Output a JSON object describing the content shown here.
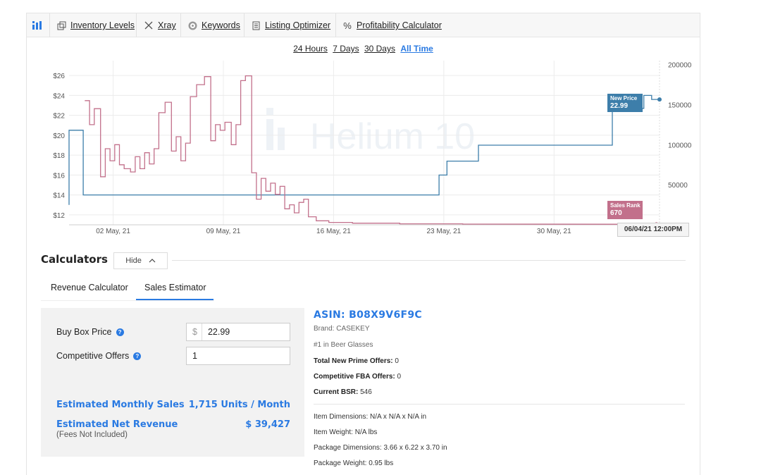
{
  "toolbar": {
    "items": [
      {
        "label": "Inventory Levels",
        "icon": "box-icon"
      },
      {
        "label": "Xray",
        "icon": "x-icon"
      },
      {
        "label": "Keywords",
        "icon": "target-icon"
      },
      {
        "label": "Listing Optimizer",
        "icon": "document-icon"
      },
      {
        "label": "Profitability Calculator",
        "icon": "percent-icon"
      }
    ]
  },
  "range": {
    "options": [
      "24 Hours",
      "7 Days",
      "30 Days",
      "All Time"
    ],
    "active": "All Time"
  },
  "chart_data": {
    "type": "line",
    "watermark": "Helium 10",
    "x_tick_labels": [
      "02 May, 21",
      "09 May, 21",
      "16 May, 21",
      "23 May, 21",
      "30 May, 21"
    ],
    "y_left_ticks": [
      "$12",
      "$14",
      "$16",
      "$18",
      "$20",
      "$22",
      "$24",
      "$26"
    ],
    "y_right_ticks": [
      "50000",
      "100000",
      "150000",
      "200000"
    ],
    "ylim_left": [
      11,
      27.5
    ],
    "ylim_right": [
      0,
      205000
    ],
    "x_range_days": [
      0,
      37.5
    ],
    "colors": {
      "price": "#3d7eaa",
      "rank": "#c2708b"
    },
    "series": [
      {
        "name": "New Price",
        "axis": "left",
        "callout": "22.99",
        "points": [
          [
            0,
            13
          ],
          [
            0,
            20.5
          ],
          [
            0.9,
            20.5
          ],
          [
            0.9,
            14
          ],
          [
            23.5,
            14
          ],
          [
            23.5,
            16
          ],
          [
            24,
            16
          ],
          [
            24,
            17.4
          ],
          [
            26,
            17.4
          ],
          [
            26,
            19
          ],
          [
            34.5,
            19
          ],
          [
            34.5,
            22.7
          ],
          [
            36.5,
            22.7
          ],
          [
            36.5,
            24
          ],
          [
            37,
            24
          ],
          [
            37,
            23.6
          ],
          [
            37.5,
            23.6
          ]
        ]
      },
      {
        "name": "Sales Rank",
        "axis": "right",
        "callout": "670",
        "points": [
          [
            1,
            155000
          ],
          [
            1.3,
            155000
          ],
          [
            1.3,
            125000
          ],
          [
            1.6,
            125000
          ],
          [
            1.6,
            145000
          ],
          [
            2,
            145000
          ],
          [
            2,
            60000
          ],
          [
            2.3,
            60000
          ],
          [
            2.3,
            95000
          ],
          [
            2.6,
            95000
          ],
          [
            2.6,
            80000
          ],
          [
            2.9,
            80000
          ],
          [
            2.9,
            100000
          ],
          [
            3.2,
            100000
          ],
          [
            3.2,
            75000
          ],
          [
            3.5,
            75000
          ],
          [
            3.5,
            70000
          ],
          [
            3.9,
            70000
          ],
          [
            3.9,
            66000
          ],
          [
            4.2,
            66000
          ],
          [
            4.2,
            85000
          ],
          [
            4.5,
            85000
          ],
          [
            4.5,
            70000
          ],
          [
            4.8,
            70000
          ],
          [
            4.8,
            90000
          ],
          [
            5.1,
            90000
          ],
          [
            5.1,
            76000
          ],
          [
            5.4,
            76000
          ],
          [
            5.4,
            95000
          ],
          [
            5.7,
            95000
          ],
          [
            5.7,
            140000
          ],
          [
            6.1,
            140000
          ],
          [
            6.1,
            153000
          ],
          [
            6.5,
            153000
          ],
          [
            6.5,
            92000
          ],
          [
            6.8,
            92000
          ],
          [
            6.8,
            110000
          ],
          [
            7.1,
            110000
          ],
          [
            7.1,
            80000
          ],
          [
            7.4,
            80000
          ],
          [
            7.4,
            102000
          ],
          [
            7.7,
            102000
          ],
          [
            7.7,
            160000
          ],
          [
            8.1,
            160000
          ],
          [
            8.1,
            175000
          ],
          [
            8.6,
            175000
          ],
          [
            8.6,
            185000
          ],
          [
            9,
            185000
          ],
          [
            9,
            105000
          ],
          [
            9.3,
            105000
          ],
          [
            9.3,
            125000
          ],
          [
            9.6,
            125000
          ],
          [
            9.6,
            118000
          ],
          [
            9.9,
            118000
          ],
          [
            9.9,
            128000
          ],
          [
            10.3,
            128000
          ],
          [
            10.3,
            100000
          ],
          [
            10.6,
            100000
          ],
          [
            10.6,
            125000
          ],
          [
            10.9,
            125000
          ],
          [
            10.9,
            180000
          ],
          [
            11.2,
            180000
          ],
          [
            11.2,
            186000
          ],
          [
            11.6,
            186000
          ],
          [
            11.6,
            65000
          ],
          [
            11.9,
            65000
          ],
          [
            11.9,
            32000
          ],
          [
            12.2,
            32000
          ],
          [
            12.2,
            58000
          ],
          [
            12.5,
            58000
          ],
          [
            12.5,
            42000
          ],
          [
            12.8,
            42000
          ],
          [
            12.8,
            52000
          ],
          [
            13.1,
            52000
          ],
          [
            13.1,
            38000
          ],
          [
            13.4,
            38000
          ],
          [
            13.4,
            48000
          ],
          [
            13.7,
            48000
          ],
          [
            13.7,
            20000
          ],
          [
            14,
            20000
          ],
          [
            14,
            25000
          ],
          [
            14.3,
            25000
          ],
          [
            14.3,
            15000
          ],
          [
            14.6,
            15000
          ],
          [
            14.6,
            28000
          ],
          [
            14.9,
            28000
          ],
          [
            14.9,
            32000
          ],
          [
            15.2,
            32000
          ],
          [
            15.2,
            10000
          ],
          [
            15.7,
            10000
          ],
          [
            15.7,
            5000
          ],
          [
            16.5,
            5000
          ],
          [
            16.5,
            3000
          ],
          [
            18,
            3000
          ],
          [
            18,
            2000
          ],
          [
            21,
            2000
          ],
          [
            21,
            1200
          ],
          [
            25,
            1200
          ],
          [
            25,
            900
          ],
          [
            37.3,
            670
          ]
        ]
      }
    ]
  },
  "date_stamp": "06/04/21 12:00PM",
  "calculators": {
    "title": "Calculators",
    "hide_label": "Hide",
    "tabs": [
      "Revenue Calculator",
      "Sales Estimator"
    ],
    "active_tab": "Sales Estimator",
    "buy_box_label": "Buy Box Price",
    "buy_box_currency": "$",
    "buy_box_value": "22.99",
    "offers_label": "Competitive Offers",
    "offers_value": "1",
    "est_sales_label": "Estimated Monthly Sales",
    "est_sales_value": "1,715 Units / Month",
    "est_rev_label": "Estimated Net Revenue",
    "est_rev_value": "$ 39,427",
    "est_rev_note": "(Fees Not Included)"
  },
  "product": {
    "asin": "ASIN: B08X9V6F9C",
    "brand": "Brand: CASEKEY",
    "rank": "#1 in Beer Glasses",
    "prime_label": "Total New Prime Offers:",
    "prime_value": "0",
    "fba_label": "Competitive FBA Offers:",
    "fba_value": "0",
    "bsr_label": "Current BSR:",
    "bsr_value": "546",
    "item_dims": "Item Dimensions: N/A x N/A x N/A in",
    "item_weight": "Item Weight: N/A lbs",
    "pkg_dims": "Package Dimensions: 3.66 x 6.22 x 3.70 in",
    "pkg_weight": "Package Weight: 0.95 lbs"
  }
}
